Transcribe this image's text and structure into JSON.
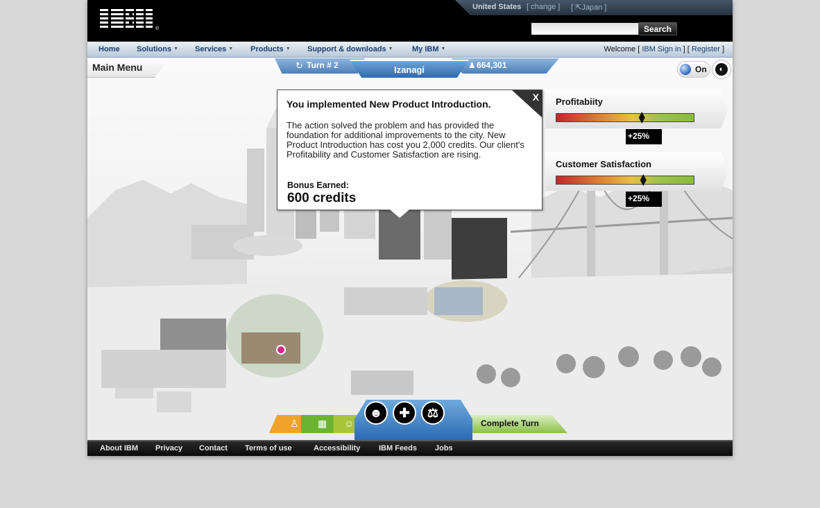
{
  "masthead": {
    "logo": "IBM",
    "country": "United States",
    "change_link": "[ change ]",
    "japan_link": "[ ⇱Japan ]",
    "search_placeholder": "",
    "search_button": "Search"
  },
  "nav": {
    "items": [
      "Home",
      "Solutions",
      "Services",
      "Products",
      "Support & downloads",
      "My IBM"
    ],
    "welcome_text": "Welcome [",
    "sign_in": "IBM Sign in",
    "sep": "] [",
    "register": "Register",
    "close": "]"
  },
  "game": {
    "main_menu": "Main Menu",
    "turn": "Turn # 2",
    "city": "Izanagi",
    "population": "664,301",
    "toggle_label": "On",
    "popup": {
      "title": "You implemented New Product Introduction.",
      "body": "The action solved the problem and has provided the foundation for additional improvements to the city. New Product Introduction has cost you 2,000 credits. Our client's Profitability and Customer Satisfaction are rising.",
      "bonus_label": "Bonus Earned:",
      "bonus_value": "600 credits",
      "close_label": "X"
    },
    "meters": [
      {
        "title": "Profitabiity",
        "level": 0.62,
        "delta": "+25%"
      },
      {
        "title": "Customer Satisfaction",
        "level": 0.63,
        "delta": "+25%"
      }
    ],
    "complete_turn": "Complete Turn"
  },
  "colors": {
    "nav_text": "#1a3d6e",
    "turn_blue": "#2c6bb3",
    "complete_green": "#8cc04a"
  },
  "footer": {
    "links": [
      "About IBM",
      "Privacy",
      "Contact",
      "Terms of use",
      "Accessibility",
      "IBM Feeds",
      "Jobs"
    ]
  }
}
